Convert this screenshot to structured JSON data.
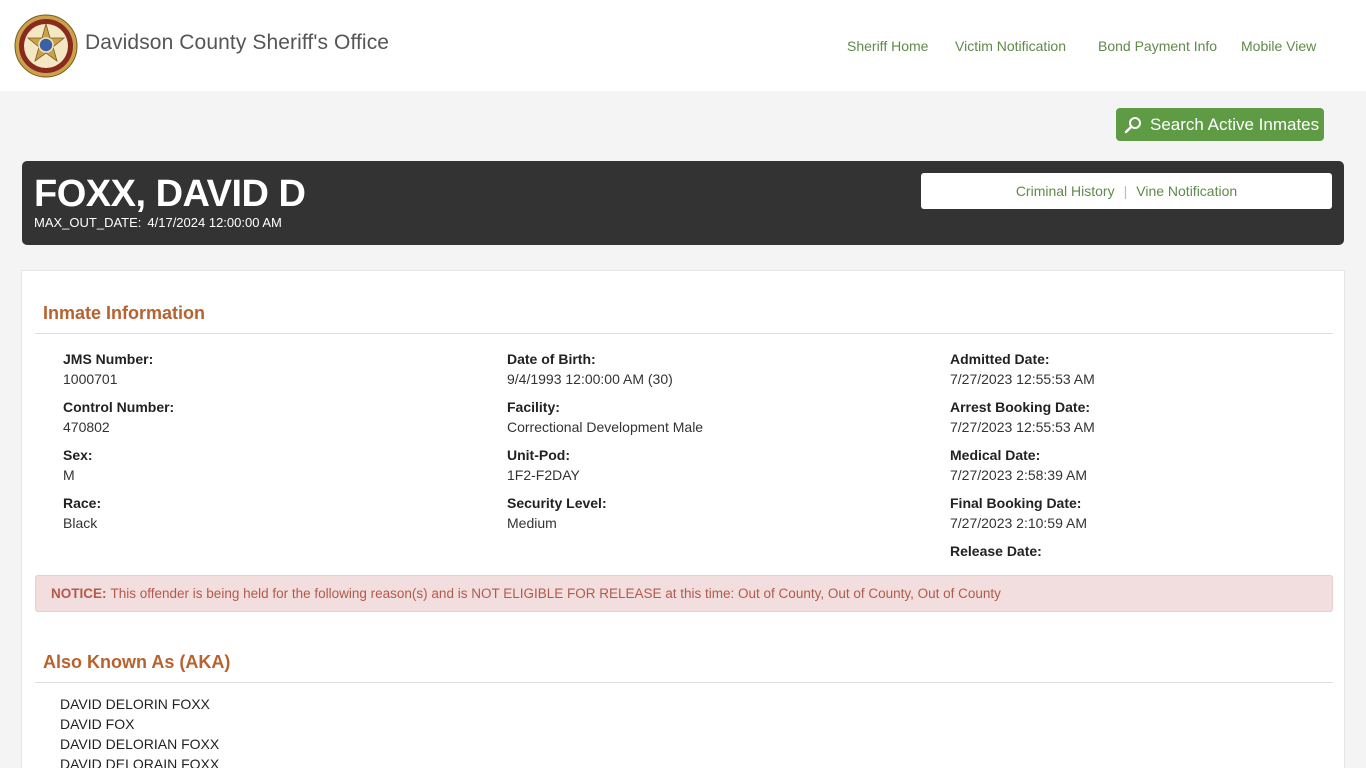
{
  "site": {
    "title": "Davidson County Sheriff's Office",
    "logo_icon": "sheriff-star-badge-icon"
  },
  "nav": [
    {
      "label": "Sheriff Home"
    },
    {
      "label": "Victim Notification"
    },
    {
      "label": "Bond Payment Info"
    },
    {
      "label": "Mobile View"
    }
  ],
  "search_button": {
    "label": "Search Active Inmates",
    "icon": "search-icon"
  },
  "inmate": {
    "name": "FOXX, DAVID D",
    "max_out_label": "MAX_OUT_DATE:",
    "max_out_value": "4/17/2024 12:00:00 AM"
  },
  "header_links": {
    "criminal_history": "Criminal History",
    "separator": "|",
    "vine_notification": "Vine Notification"
  },
  "inmate_info": {
    "title": "Inmate Information",
    "col1": [
      {
        "label": "JMS Number:",
        "value": "1000701"
      },
      {
        "label": "Control Number:",
        "value": "470802"
      },
      {
        "label": "Sex:",
        "value": "M"
      },
      {
        "label": "Race:",
        "value": "Black"
      }
    ],
    "col2": [
      {
        "label": "Date of Birth:",
        "value": "9/4/1993 12:00:00 AM (30)"
      },
      {
        "label": "Facility:",
        "value": "Correctional Development Male"
      },
      {
        "label": "Unit-Pod:",
        "value": "1F2-F2DAY"
      },
      {
        "label": "Security Level:",
        "value": "Medium"
      }
    ],
    "col3": [
      {
        "label": "Admitted Date:",
        "value": "7/27/2023 12:55:53 AM"
      },
      {
        "label": "Arrest Booking Date:",
        "value": "7/27/2023 12:55:53 AM"
      },
      {
        "label": "Medical Date:",
        "value": "7/27/2023 2:58:39 AM"
      },
      {
        "label": "Final Booking Date:",
        "value": "7/27/2023 2:10:59 AM"
      },
      {
        "label": "Release Date:",
        "value": ""
      }
    ]
  },
  "notice": {
    "label": "NOTICE:",
    "text": "This offender is being held for the following reason(s) and is NOT ELIGIBLE FOR RELEASE at this time: Out of County, Out of County, Out of County"
  },
  "aka": {
    "title": "Also Known As (AKA)",
    "names": [
      "DAVID DELORIN FOXX",
      "DAVID FOX",
      "DAVID DELORIAN FOXX",
      "DAVID DELORAIN FOXX"
    ]
  },
  "colors": {
    "accent_green": "#5f9a45",
    "link_green": "#5f8a4a",
    "section_orange": "#b8622f",
    "header_dark": "#333333",
    "notice_bg": "#f2dede"
  }
}
